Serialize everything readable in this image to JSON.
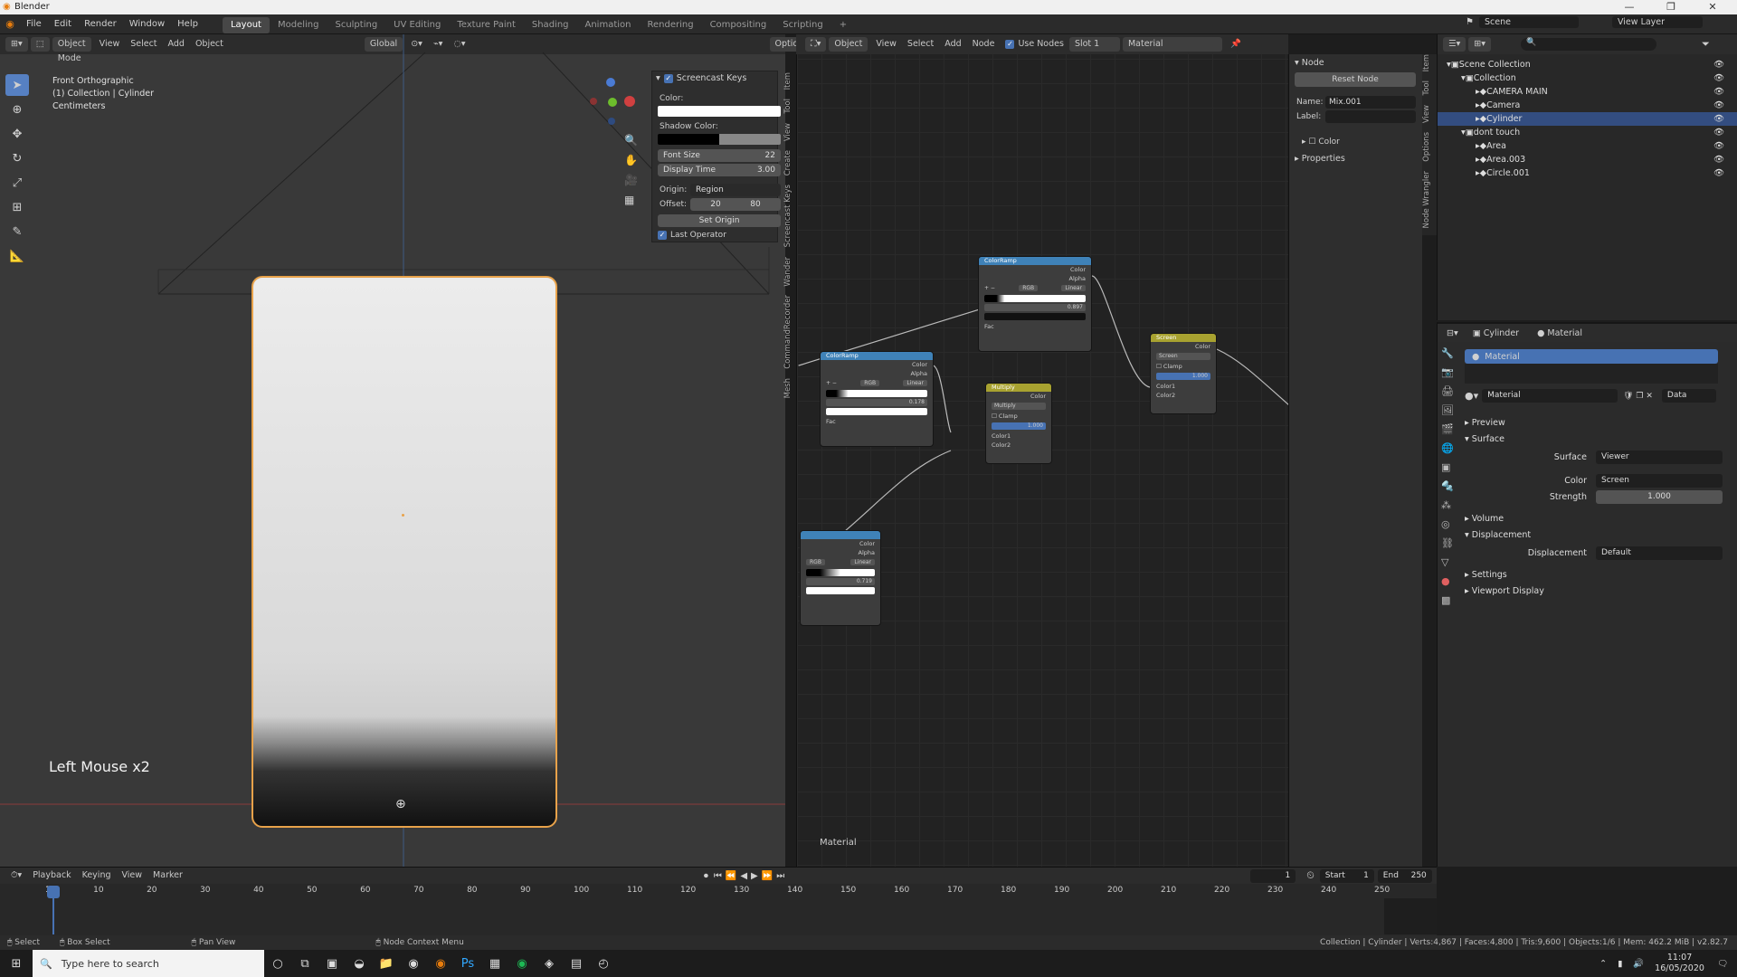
{
  "window": {
    "title": "Blender",
    "minimize": "—",
    "restore": "❐",
    "close": "✕"
  },
  "menu": [
    "File",
    "Edit",
    "Render",
    "Window",
    "Help"
  ],
  "workspaces": [
    "Layout",
    "Modeling",
    "Sculpting",
    "UV Editing",
    "Texture Paint",
    "Shading",
    "Animation",
    "Rendering",
    "Compositing",
    "Scripting",
    "+"
  ],
  "scene": {
    "label": "Scene",
    "view_layer": "View Layer"
  },
  "viewport": {
    "mode": "Object Mode",
    "menus": [
      "View",
      "Select",
      "Add",
      "Object"
    ],
    "orientation": "Global",
    "options": "Options",
    "view_name": "Front Orthographic",
    "collection_info": "(1) Collection | Cylinder",
    "units": "Centimeters",
    "keystroke": "Left Mouse x2"
  },
  "npanel": {
    "title": "Screencast Keys",
    "color_label": "Color:",
    "shadow_label": "Shadow Color:",
    "font_size_label": "Font Size",
    "font_size": "22",
    "display_time_label": "Display Time",
    "display_time": "3.00",
    "origin_label": "Origin:",
    "origin": "Region",
    "offset_label": "Offset:",
    "offset_x": "20",
    "offset_y": "80",
    "set_origin": "Set Origin",
    "last_operator": "Last Operator",
    "tabs": [
      "Item",
      "Tool",
      "View",
      "Create",
      "Screencast Keys",
      "Wander",
      "CommandRecorder",
      "Mesh"
    ]
  },
  "node_editor": {
    "menus": [
      "View",
      "Select",
      "Add",
      "Node"
    ],
    "object": "Object",
    "use_nodes": "Use Nodes",
    "slot": "Slot 1",
    "material": "Material",
    "footer": "Material",
    "nodes": {
      "ramp1": {
        "title": "ColorRamp",
        "out1": "Color",
        "out2": "Alpha",
        "mode": "RGB",
        "interp": "Linear",
        "pos": "0.897",
        "fac": "Fac"
      },
      "ramp2": {
        "title": "ColorRamp",
        "out1": "Color",
        "out2": "Alpha",
        "mode": "RGB",
        "interp": "Linear",
        "pos": "0.178",
        "fac": "Fac"
      },
      "ramp3": {
        "title": "",
        "out1": "Color",
        "out2": "Alpha",
        "mode": "RGB",
        "interp": "Linear",
        "pos": "0.719"
      },
      "multiply": {
        "title": "Multiply",
        "out": "Color",
        "mode": "Multiply",
        "clamp": "Clamp",
        "fac": "1.000",
        "c1": "Color1",
        "c2": "Color2"
      },
      "screen": {
        "title": "Screen",
        "out": "Color",
        "mode": "Screen",
        "clamp": "Clamp",
        "fac": "1.000",
        "c1": "Color1",
        "c2": "Color2"
      }
    }
  },
  "node_side": {
    "header": "Node",
    "reset": "Reset Node",
    "name_label": "Name:",
    "name": "Mix.001",
    "label_label": "Label:",
    "color": "Color",
    "properties": "Properties",
    "tabs": [
      "Item",
      "Tool",
      "View",
      "Options",
      "Node Wrangler"
    ]
  },
  "outliner": {
    "rows": [
      {
        "name": "Scene Collection",
        "indent": 0,
        "selected": false
      },
      {
        "name": "Collection",
        "indent": 1,
        "selected": false
      },
      {
        "name": "CAMERA MAIN",
        "indent": 2,
        "selected": false
      },
      {
        "name": "Camera",
        "indent": 2,
        "selected": false
      },
      {
        "name": "Cylinder",
        "indent": 2,
        "selected": true
      },
      {
        "name": "dont touch",
        "indent": 1,
        "selected": false
      },
      {
        "name": "Area",
        "indent": 2,
        "selected": false
      },
      {
        "name": "Area.003",
        "indent": 2,
        "selected": false
      },
      {
        "name": "Circle.001",
        "indent": 2,
        "selected": false
      }
    ]
  },
  "properties": {
    "object": "Cylinder",
    "material_tab": "Material",
    "slot_name": "Material",
    "mat_name": "Material",
    "data": "Data",
    "sections": {
      "preview": "Preview",
      "surface": "Surface",
      "volume": "Volume",
      "displacement": "Displacement",
      "settings": "Settings",
      "viewport_display": "Viewport Display"
    },
    "surface_label": "Surface",
    "surface_value": "Viewer",
    "color_label": "Color",
    "color_value": "Screen",
    "strength_label": "Strength",
    "strength_value": "1.000",
    "disp_label": "Displacement",
    "disp_value": "Default"
  },
  "timeline": {
    "menus": [
      "Playback",
      "Keying",
      "View",
      "Marker"
    ],
    "current_frame": "1",
    "start_label": "Start",
    "start": "1",
    "end_label": "End",
    "end": "250",
    "ticks": [
      "1",
      "10",
      "20",
      "30",
      "40",
      "50",
      "60",
      "70",
      "80",
      "90",
      "100",
      "110",
      "120",
      "130",
      "140",
      "150",
      "160",
      "170",
      "180",
      "190",
      "200",
      "210",
      "220",
      "230",
      "240",
      "250"
    ]
  },
  "status": {
    "select": "Select",
    "box_select": "Box Select",
    "pan_view": "Pan View",
    "context": "Node Context Menu",
    "info": "Collection | Cylinder | Verts:4,867 | Faces:4,800 | Tris:9,600 | Objects:1/6 | Mem: 462.2 MiB | v2.82.7"
  },
  "taskbar": {
    "search": "Type here to search",
    "time": "11:07",
    "date": "16/05/2020"
  }
}
